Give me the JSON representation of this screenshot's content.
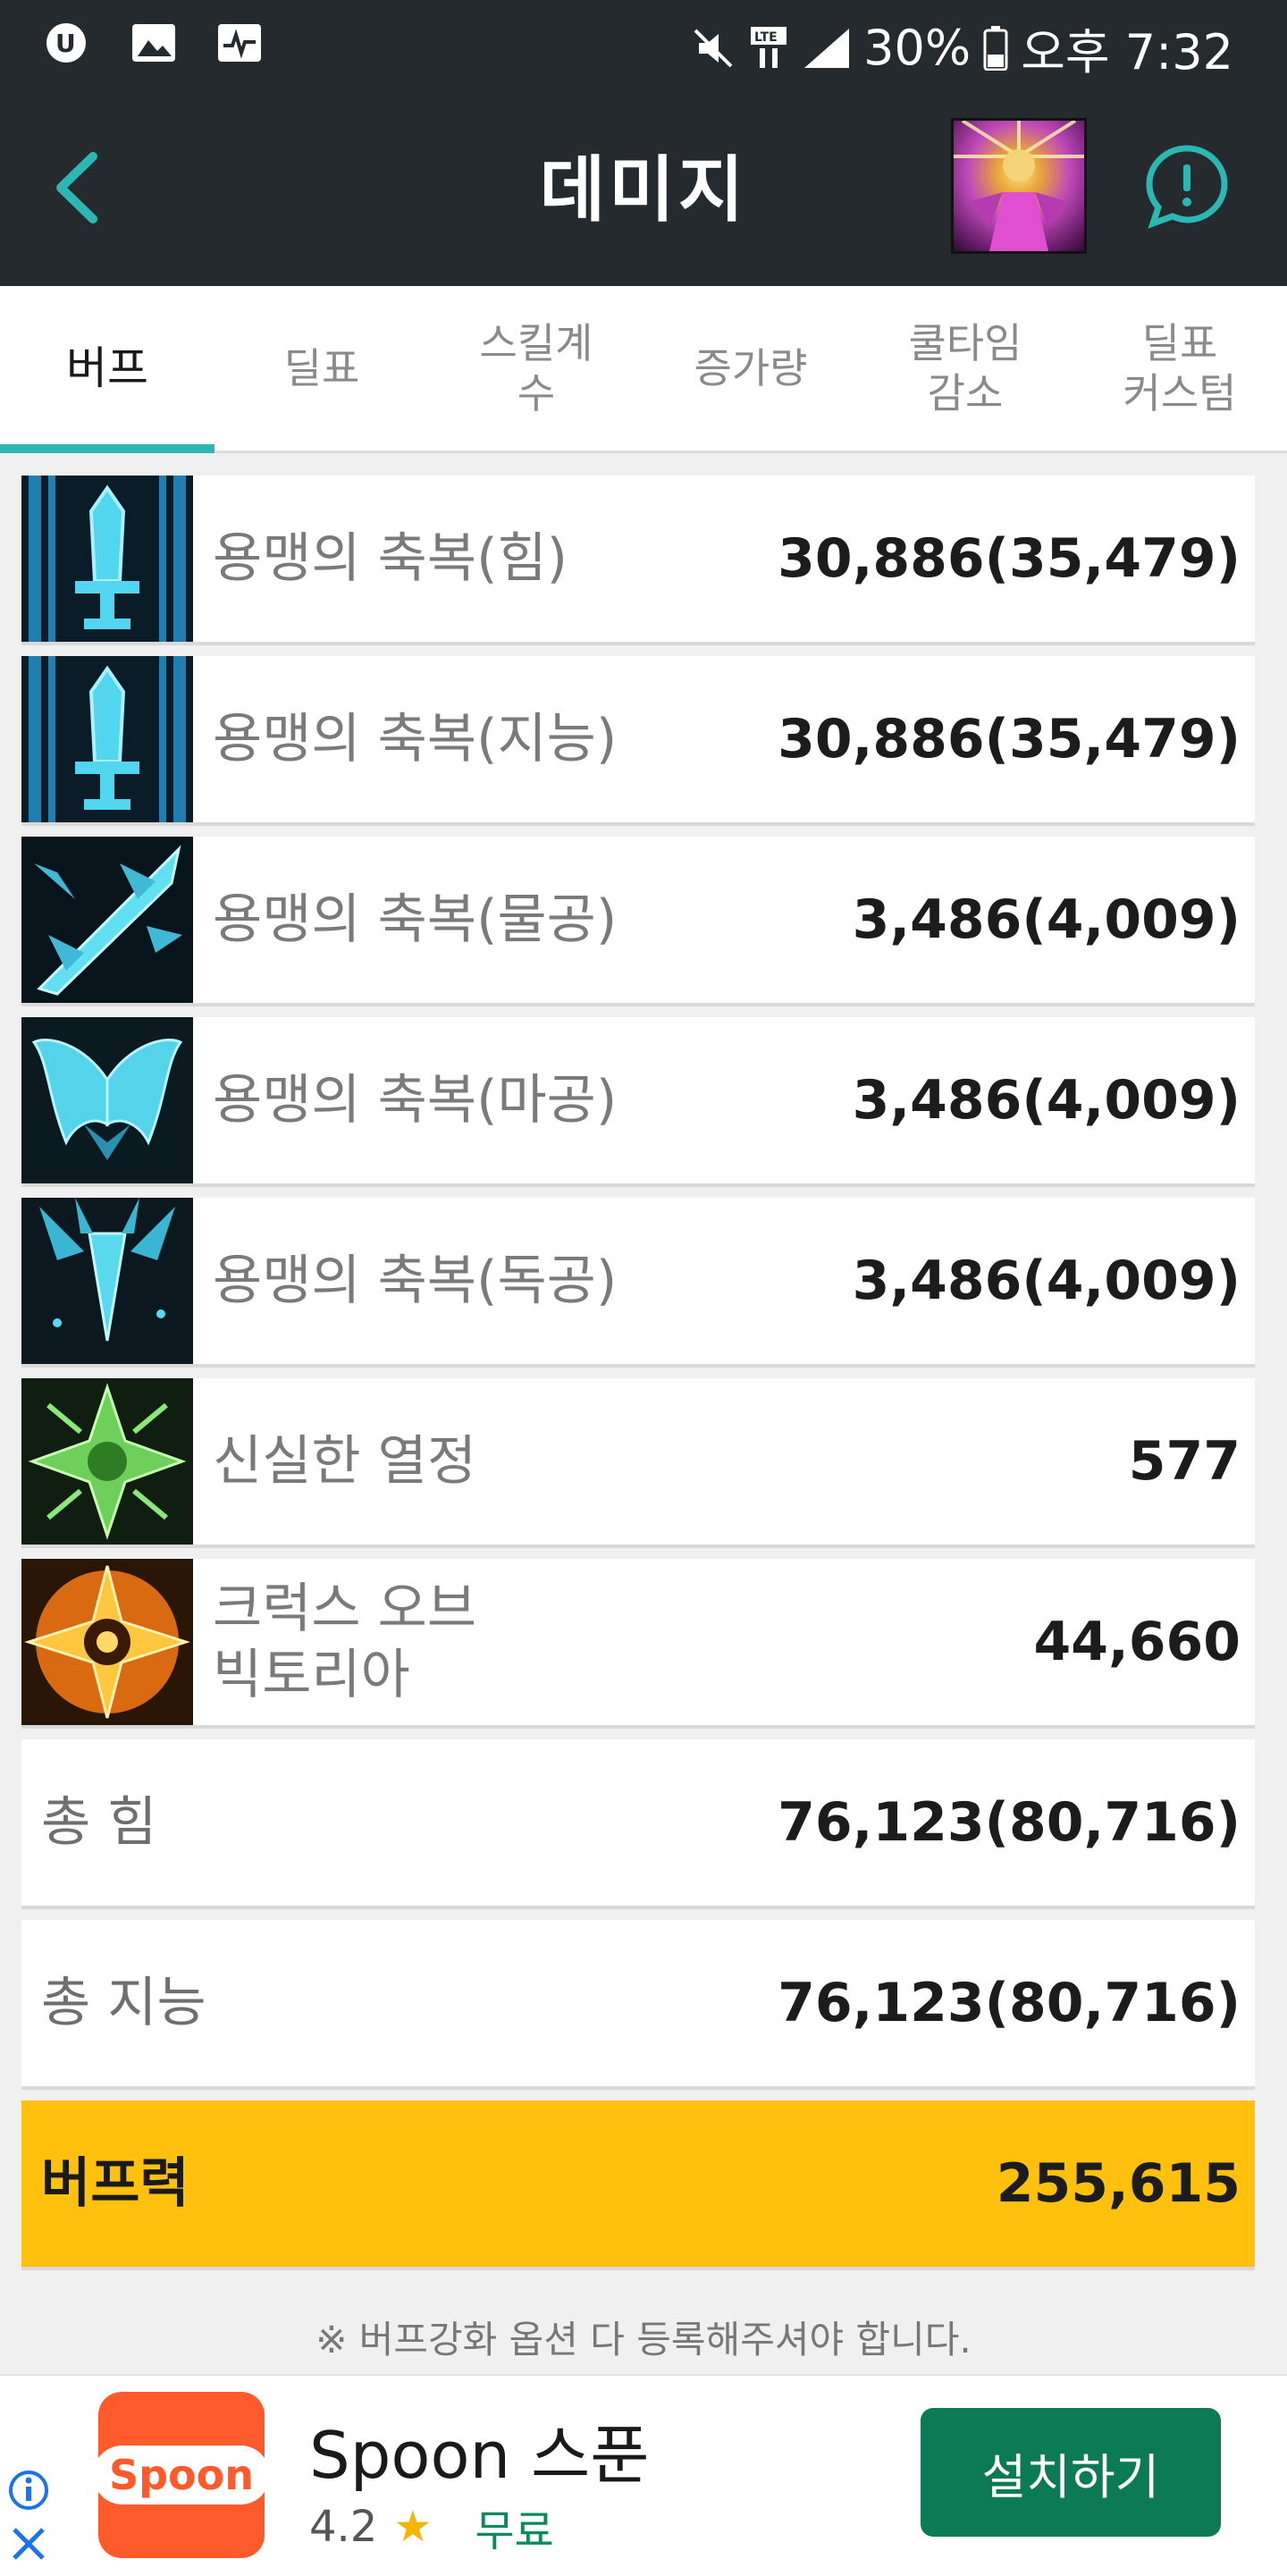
{
  "status_bar": {
    "battery": "30%",
    "time": "오후 7:32",
    "network": "LTE"
  },
  "app_bar": {
    "title": "데미지"
  },
  "tabs": [
    {
      "label": "버프",
      "active": true
    },
    {
      "label": "딜표",
      "active": false
    },
    {
      "label": "스킬계\n수",
      "active": false
    },
    {
      "label": "증가량",
      "active": false
    },
    {
      "label": "쿨타임\n감소",
      "active": false
    },
    {
      "label": "딜표\n커스텀",
      "active": false
    }
  ],
  "buff_rows": [
    {
      "name": "용맹의 축복(힘)",
      "value": "30,886(35,479)",
      "icon": "sword-icon"
    },
    {
      "name": "용맹의 축복(지능)",
      "value": "30,886(35,479)",
      "icon": "sword-icon"
    },
    {
      "name": "용맹의 축복(물공)",
      "value": "3,486(4,009)",
      "icon": "slash-icon"
    },
    {
      "name": "용맹의 축복(마공)",
      "value": "3,486(4,009)",
      "icon": "wings-icon"
    },
    {
      "name": "용맹의 축복(독공)",
      "value": "3,486(4,009)",
      "icon": "blade-icon"
    },
    {
      "name": "신실한 열정",
      "value": "577",
      "icon": "cross-icon"
    },
    {
      "name": "크럭스 오브\n빅토리아",
      "value": "44,660",
      "icon": "crux-icon"
    }
  ],
  "totals": [
    {
      "name": "총 힘",
      "value": "76,123(80,716)"
    },
    {
      "name": "총 지능",
      "value": "76,123(80,716)"
    }
  ],
  "buff_power": {
    "name": "버프력",
    "value": "255,615"
  },
  "note": "※ 버프강화 옵션 다 등록해주셔야 합니다.",
  "ad": {
    "logo_text": "Spoon",
    "title": "Spoon 스푼",
    "rating": "4.2",
    "price": "무료",
    "install": "설치하기"
  },
  "colors": {
    "header_bg": "#252a2e",
    "accent": "#2bb8b3",
    "buff_power_bg": "#ffc10e",
    "install_bg": "#0b7a55"
  }
}
